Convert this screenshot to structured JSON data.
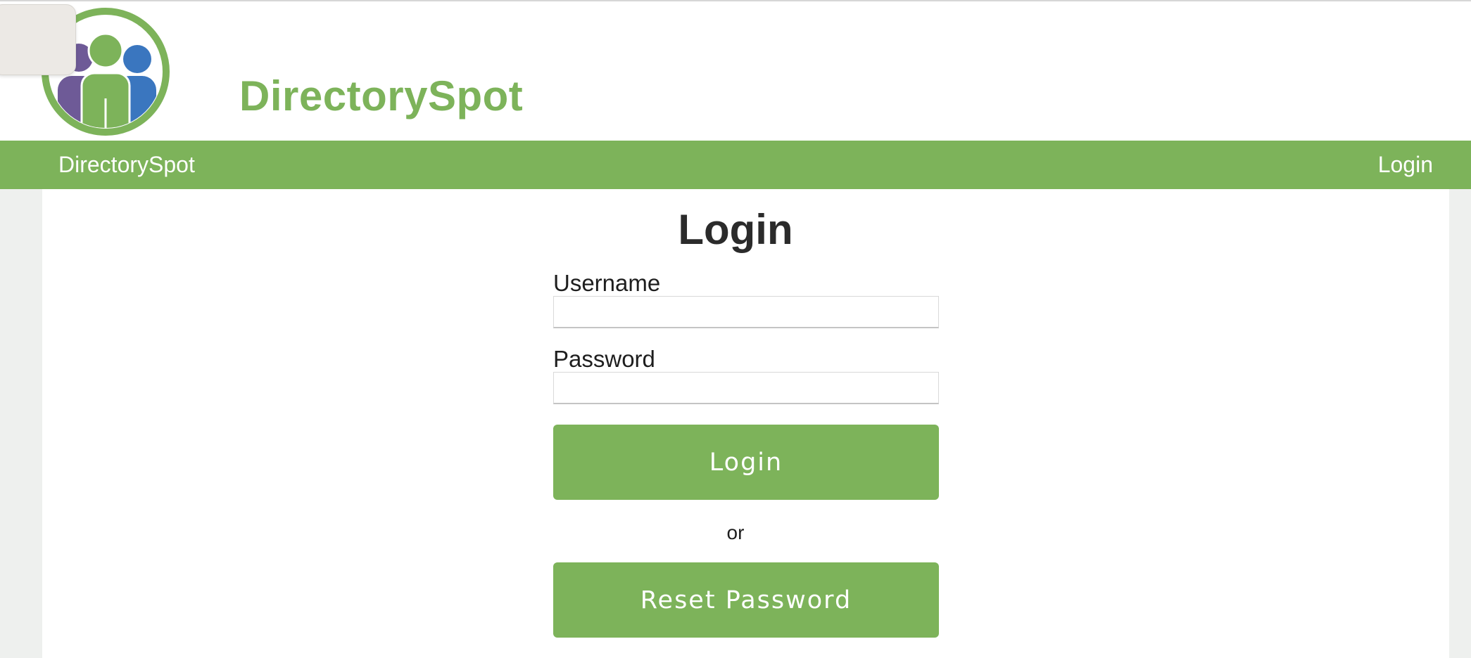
{
  "header": {
    "brand_text": "DirectorySpot",
    "logo_icon": "people-group-logo-icon"
  },
  "navbar": {
    "brand_link": "DirectorySpot",
    "login_link": "Login"
  },
  "login_form": {
    "title": "Login",
    "username_label": "Username",
    "username_value": "",
    "password_label": "Password",
    "password_value": "",
    "login_button": "Login",
    "or_text": "or",
    "reset_button": "Reset Password"
  },
  "colors": {
    "brand_green": "#7db35a",
    "logo_purple": "#6e5a97",
    "logo_blue": "#3a76bf",
    "title_text": "#2b2b2b"
  }
}
